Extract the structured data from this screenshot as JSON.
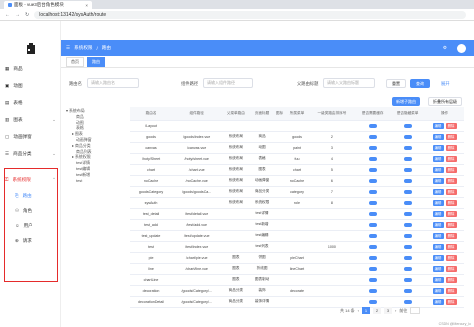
{
  "browser": {
    "tab_title": "面板 - vue3后台角色模块",
    "url": "localhost:13142/sysAuth/route"
  },
  "sidebar": {
    "items": [
      {
        "label": "商品",
        "icon": "grid-icon"
      },
      {
        "label": "动图",
        "icon": "image-icon"
      },
      {
        "label": "表格",
        "icon": "table-icon"
      },
      {
        "label": "图表",
        "icon": "chart-icon"
      },
      {
        "label": "动画弹窗",
        "icon": "window-icon"
      },
      {
        "label": "商品分类",
        "icon": "list-icon"
      },
      {
        "label": "系统权限",
        "icon": "lock-icon"
      }
    ],
    "subitems": [
      {
        "label": "路由",
        "icon": "route-icon"
      },
      {
        "label": "角色",
        "icon": "role-icon"
      },
      {
        "label": "用户",
        "icon": "user-icon"
      },
      {
        "label": "请求",
        "icon": "request-icon"
      }
    ]
  },
  "header": {
    "crumb1": "系统权限",
    "crumb2": "路由"
  },
  "tags": [
    "首页",
    "路由"
  ],
  "search": {
    "label1": "路由名",
    "ph1": "请输入路由名",
    "label2": "组件路径",
    "ph2": "请输入组件路径",
    "label3": "父路由标题",
    "ph3": "请输入父路由标题",
    "reset": "重置",
    "query": "查询",
    "expand": "展开",
    "add": "新增子路由",
    "collapse": "折叠所有层级"
  },
  "tree": [
    "系统布局",
    "商品",
    "动图",
    "表格",
    "图表",
    "动画弹窗",
    "商品分类",
    "商品列表",
    "系统权限",
    "test详情",
    "test编辑",
    "test新增",
    "test"
  ],
  "table": {
    "headers": [
      "路由名",
      "组件路径",
      "父菜单路由",
      "页面标题",
      "图标",
      "所属菜单",
      "一级类路由排序号",
      "是否需要缓存",
      "是否隐藏菜单",
      "操作"
    ],
    "rows": [
      [
        "/Layout",
        "",
        "",
        "",
        "",
        "",
        "",
        "",
        "",
        ""
      ],
      [
        "goods",
        "/goods/index.vue",
        "系统布局",
        "商品",
        "",
        "goods",
        "2",
        "",
        "",
        ""
      ],
      [
        "canvas",
        "/canvas.vue",
        "系统布局",
        "动图",
        "",
        "paint",
        "3",
        "",
        "",
        ""
      ],
      [
        "/hoty/Sheet",
        "/hoty/sheet.vue",
        "系统布局",
        "表格",
        "",
        "fuu",
        "4",
        "",
        "",
        ""
      ],
      [
        "chart",
        "/chart.vue",
        "系统布局",
        "图表",
        "",
        "chart",
        "5",
        "",
        "",
        ""
      ],
      [
        "noCache",
        "/noCache.vue",
        "系统布局",
        "动画弹窗",
        "",
        "noCache",
        "6",
        "",
        "",
        ""
      ],
      [
        "goodsCategory",
        "/goods/goodsCa...",
        "系统布局",
        "商品分类",
        "",
        "category",
        "7",
        "",
        "",
        ""
      ],
      [
        "sysAuth",
        "",
        "系统布局",
        "系统权限",
        "",
        "role",
        "8",
        "",
        "",
        ""
      ],
      [
        "test_detail",
        "/test/detail.vue",
        "",
        "test详情",
        "",
        "",
        "",
        "",
        "",
        ""
      ],
      [
        "test_add",
        "/test/add.vue",
        "",
        "test新增",
        "",
        "",
        "",
        "",
        "",
        ""
      ],
      [
        "test_update",
        "/test/update.vue",
        "",
        "test编辑",
        "",
        "",
        "",
        "",
        "",
        ""
      ],
      [
        "test",
        "/test/index.vue",
        "",
        "test列表",
        "",
        "",
        "1000",
        "",
        "",
        ""
      ],
      [
        "pie",
        "/chart/pie.vue",
        "图表",
        "饼图",
        "",
        "pieChart",
        "",
        "",
        "",
        ""
      ],
      [
        "line",
        "/chart/line.vue",
        "图表",
        "折线图",
        "",
        "lineChart",
        "",
        "",
        "",
        ""
      ],
      [
        "chartLine",
        "",
        "图表",
        "图表制动",
        "",
        "",
        "",
        "",
        "",
        ""
      ],
      [
        "decoration",
        "/goods/Category/...",
        "商品分类",
        "装饰",
        "",
        "decorate",
        "",
        "",
        "",
        ""
      ],
      [
        "decorationDetail",
        "/goods/Category/...",
        "商品分类",
        "装饰详情",
        "",
        "",
        "",
        "",
        "",
        ""
      ]
    ],
    "edit": "编辑",
    "delete": "删除"
  },
  "pager": {
    "total": "共 14 条",
    "p1": "1",
    "p2": "2",
    "p3": "3",
    "goto": "前往"
  },
  "watermark": "CSDN @Mercury_lc"
}
